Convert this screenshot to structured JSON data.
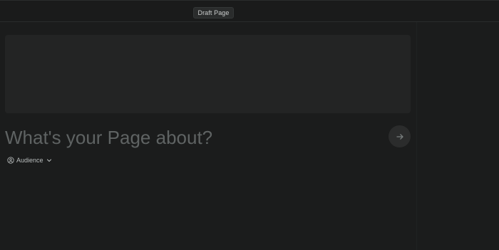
{
  "header": {
    "draft_label": "Draft Page"
  },
  "editor": {
    "title_placeholder": "What's your Page about?",
    "title_value": ""
  },
  "audience": {
    "label": "Audience",
    "icon": "user-circle-icon",
    "dropdown_icon": "chevron-down-icon"
  },
  "submit": {
    "icon": "arrow-right-icon"
  },
  "colors": {
    "background": "#1b1c1c",
    "topbar": "#1a1b1b",
    "pill": "#2a2c2c",
    "cover": "#232424",
    "placeholder": "#5f6363",
    "submit_button": "#2b2c2c",
    "text": "#b9bdbd"
  }
}
